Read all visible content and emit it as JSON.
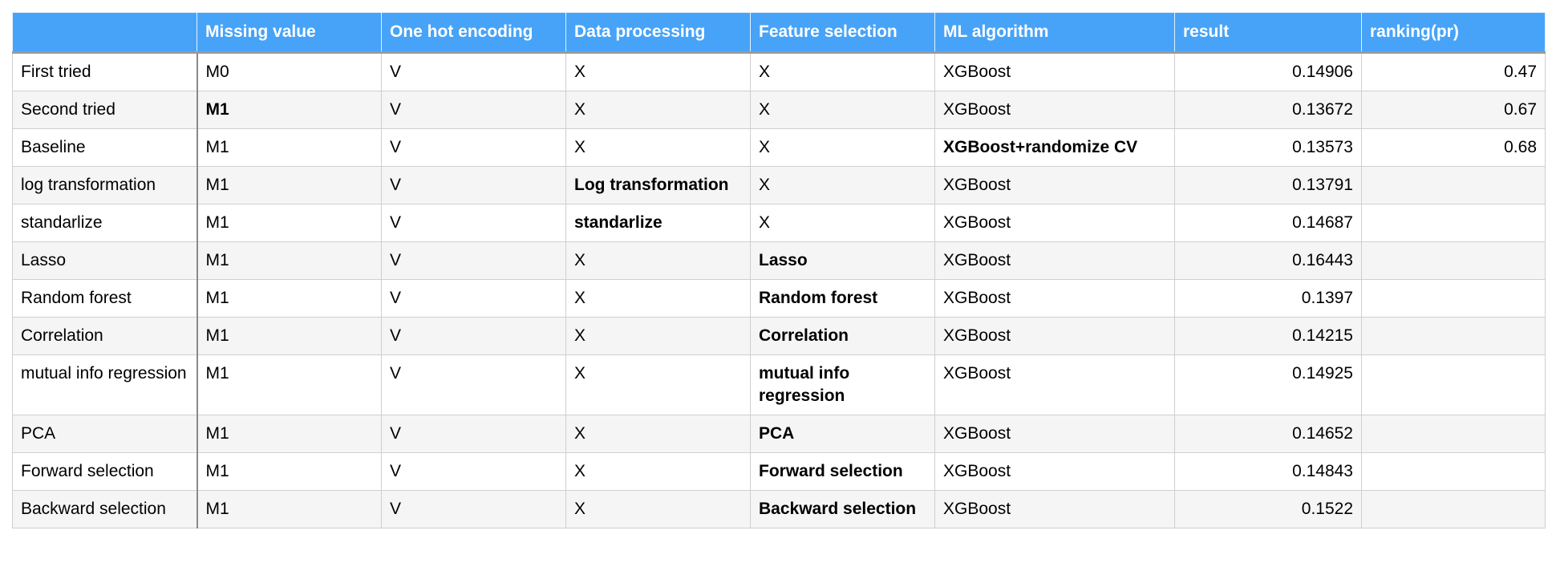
{
  "colors": {
    "header_bg": "#47a3f8",
    "header_text": "#ffffff",
    "alt_row_bg": "#f5f5f5"
  },
  "columns": [
    "",
    "Missing value",
    "One hot encoding",
    "Data processing",
    "Feature selection",
    "ML algorithm",
    "result",
    "ranking(pr)"
  ],
  "rows": [
    {
      "cells": [
        {
          "text": "First tried"
        },
        {
          "text": "M0"
        },
        {
          "text": "V"
        },
        {
          "text": "X"
        },
        {
          "text": "X"
        },
        {
          "text": "XGBoost"
        },
        {
          "text": "0.14906"
        },
        {
          "text": "0.47"
        }
      ]
    },
    {
      "cells": [
        {
          "text": "Second tried"
        },
        {
          "text": "M1",
          "bold": true
        },
        {
          "text": "V"
        },
        {
          "text": "X"
        },
        {
          "text": "X"
        },
        {
          "text": "XGBoost"
        },
        {
          "text": "0.13672"
        },
        {
          "text": "0.67"
        }
      ]
    },
    {
      "cells": [
        {
          "text": "Baseline"
        },
        {
          "text": "M1"
        },
        {
          "text": "V"
        },
        {
          "text": "X"
        },
        {
          "text": "X"
        },
        {
          "text": "XGBoost+randomize CV",
          "bold": true
        },
        {
          "text": "0.13573"
        },
        {
          "text": "0.68"
        }
      ]
    },
    {
      "cells": [
        {
          "text": "log transformation"
        },
        {
          "text": "M1"
        },
        {
          "text": "V"
        },
        {
          "text": "Log transformation",
          "bold": true
        },
        {
          "text": "X"
        },
        {
          "text": "XGBoost"
        },
        {
          "text": "0.13791"
        },
        {
          "text": ""
        }
      ]
    },
    {
      "cells": [
        {
          "text": "standarlize"
        },
        {
          "text": "M1"
        },
        {
          "text": "V"
        },
        {
          "text": "standarlize",
          "bold": true
        },
        {
          "text": "X"
        },
        {
          "text": "XGBoost"
        },
        {
          "text": "0.14687"
        },
        {
          "text": ""
        }
      ]
    },
    {
      "cells": [
        {
          "text": "Lasso"
        },
        {
          "text": "M1"
        },
        {
          "text": "V"
        },
        {
          "text": "X"
        },
        {
          "text": "Lasso",
          "bold": true
        },
        {
          "text": "XGBoost"
        },
        {
          "text": "0.16443"
        },
        {
          "text": ""
        }
      ]
    },
    {
      "cells": [
        {
          "text": "Random forest"
        },
        {
          "text": "M1"
        },
        {
          "text": "V"
        },
        {
          "text": "X"
        },
        {
          "text": "Random forest",
          "bold": true
        },
        {
          "text": "XGBoost"
        },
        {
          "text": "0.1397"
        },
        {
          "text": ""
        }
      ]
    },
    {
      "cells": [
        {
          "text": "Correlation"
        },
        {
          "text": "M1"
        },
        {
          "text": "V"
        },
        {
          "text": "X"
        },
        {
          "text": "Correlation",
          "bold": true
        },
        {
          "text": "XGBoost"
        },
        {
          "text": "0.14215"
        },
        {
          "text": ""
        }
      ]
    },
    {
      "cells": [
        {
          "text": "mutual info regression"
        },
        {
          "text": "M1"
        },
        {
          "text": "V"
        },
        {
          "text": "X"
        },
        {
          "text": "mutual info regression",
          "bold": true
        },
        {
          "text": "XGBoost"
        },
        {
          "text": "0.14925"
        },
        {
          "text": ""
        }
      ]
    },
    {
      "cells": [
        {
          "text": "PCA"
        },
        {
          "text": "M1"
        },
        {
          "text": "V"
        },
        {
          "text": "X"
        },
        {
          "text": "PCA",
          "bold": true
        },
        {
          "text": "XGBoost"
        },
        {
          "text": "0.14652"
        },
        {
          "text": ""
        }
      ]
    },
    {
      "cells": [
        {
          "text": "Forward selection"
        },
        {
          "text": "M1"
        },
        {
          "text": "V"
        },
        {
          "text": "X"
        },
        {
          "text": "Forward selection",
          "bold": true
        },
        {
          "text": "XGBoost"
        },
        {
          "text": "0.14843"
        },
        {
          "text": ""
        }
      ]
    },
    {
      "cells": [
        {
          "text": "Backward selection"
        },
        {
          "text": "M1"
        },
        {
          "text": "V"
        },
        {
          "text": "X"
        },
        {
          "text": "Backward selection",
          "bold": true
        },
        {
          "text": "XGBoost"
        },
        {
          "text": "0.1522"
        },
        {
          "text": ""
        }
      ]
    }
  ]
}
